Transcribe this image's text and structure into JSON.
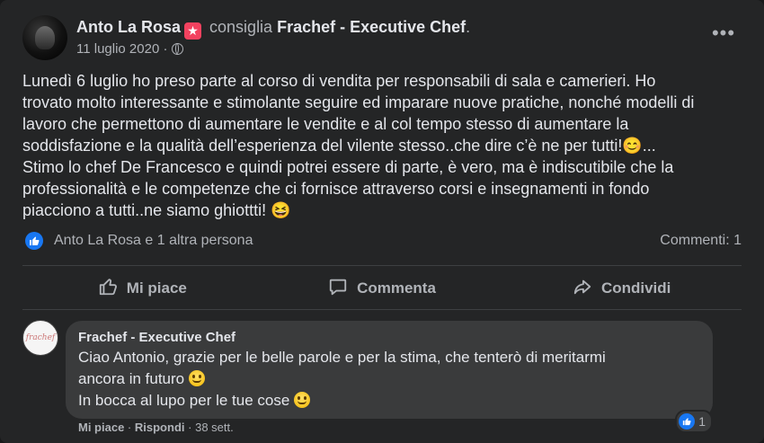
{
  "post": {
    "author": "Anto La Rosa",
    "verb": "consiglia",
    "page": "Frachef - Executive Chef",
    "trailing": ".",
    "date": "11 luglio 2020",
    "separator": "·",
    "more_label": "•••",
    "text_lines": [
      "Lunedì 6 luglio ho preso parte al corso di vendita per responsabili di sala e camerieri. Ho",
      "trovato molto interessante e stimolante seguire ed imparare nuove pratiche, nonché modelli di",
      "lavoro  che permettono di aumentare le vendite e al col tempo stesso di aumentare la",
      "soddisfazione e la qualità dell’esperienza del vilente stesso..che dire c’è ne per tutti!😊...",
      "Stimo lo chef De Francesco e quindi potrei essere di parte, è vero, ma è indiscutibile che la",
      "professionalità e le competenze che ci fornisce attraverso corsi e insegnamenti in fondo",
      "piacciono a tutti..ne siamo ghiottti! 😆"
    ],
    "reactors": "Anto La Rosa e 1 altra persona",
    "comments_count": "Commenti: 1"
  },
  "actions": {
    "like": "Mi piace",
    "comment": "Commenta",
    "share": "Condividi"
  },
  "comment": {
    "author": "Frachef - Executive Chef",
    "avatar_text": "frachef",
    "lines": [
      "Ciao Antonio, grazie per le belle parole e per la stima, che tenterò di meritarmi",
      "ancora in futuro",
      "In bocca al lupo per le tue cose"
    ],
    "like_label": "Mi piace",
    "reply_label": "Rispondi",
    "time": "38 sett.",
    "reaction_count": "1"
  },
  "icons": {
    "like": "thumbs-up-icon",
    "comment": "speech-bubble-icon",
    "share": "share-arrow-icon",
    "privacy": "globe-icon",
    "more": "more-icon",
    "badge": "recommend-star-icon"
  },
  "colors": {
    "background": "#242526",
    "text": "#e4e6eb",
    "muted": "#b0b3b8",
    "accent": "#1877f2",
    "badge": "#f3425f"
  }
}
